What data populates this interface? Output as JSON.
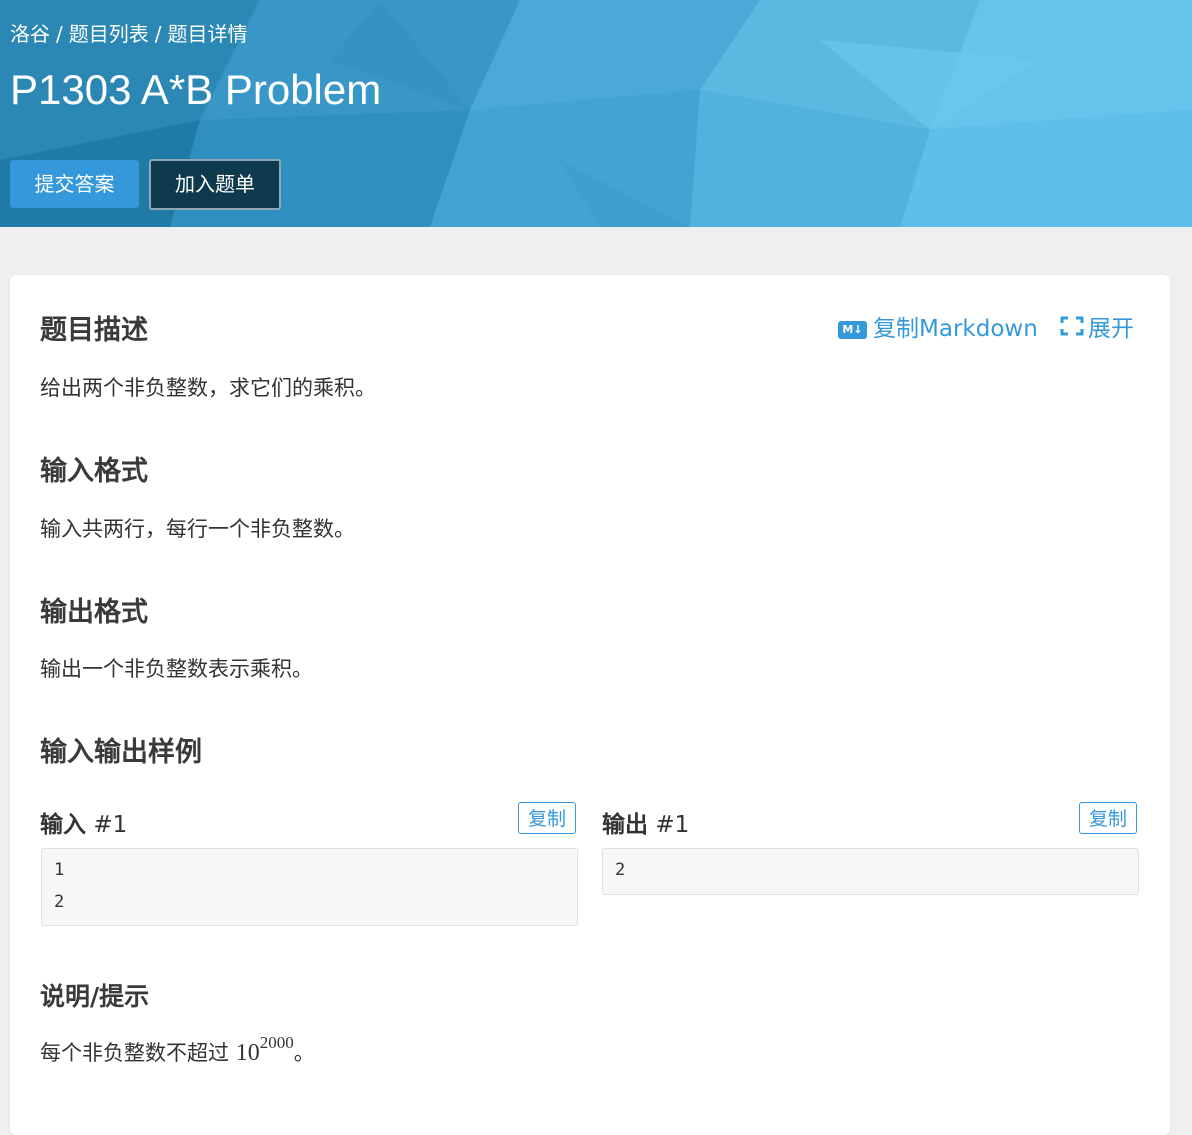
{
  "breadcrumb": [
    "洛谷",
    "题目列表",
    "题目详情"
  ],
  "breadcrumb_separator": "/",
  "title": "P1303 A*B Problem",
  "actions": {
    "submit_label": "提交答案",
    "add_list_label": "加入题单"
  },
  "toolbar": {
    "copy_markdown_label": "复制Markdown",
    "md_icon_text": "M↓",
    "expand_label": "展开"
  },
  "sections": {
    "description": {
      "title": "题目描述",
      "text": "给出两个非负整数，求它们的乘积。"
    },
    "input_format": {
      "title": "输入格式",
      "text": "输入共两行，每行一个非负整数。"
    },
    "output_format": {
      "title": "输出格式",
      "text": "输出一个非负整数表示乘积。"
    },
    "samples": {
      "title": "输入输出样例",
      "input_label": "输入",
      "output_label": "输出",
      "index": "#1",
      "copy_label": "复制",
      "input_lines": [
        "1",
        "2"
      ],
      "output_lines": [
        "2"
      ]
    },
    "hint": {
      "title": "说明/提示",
      "text_prefix": "每个非负整数不超过",
      "math_base": "10",
      "math_exp": "2000",
      "text_suffix": "。"
    }
  },
  "colors": {
    "accent": "#3498db",
    "header_bg": "#3a9fd0",
    "dark_button": "#0f3a4e",
    "page_bg": "#efefef"
  }
}
